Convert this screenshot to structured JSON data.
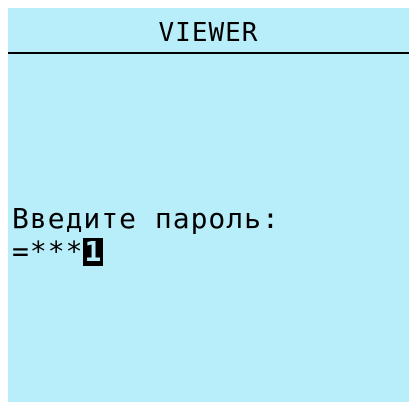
{
  "screen": {
    "title": "VIEWER",
    "prompt": "Введите пароль:",
    "password": {
      "prefix": "=",
      "masked": "***",
      "cursor_digit": "1"
    }
  },
  "colors": {
    "lcd_background": "#b8eefa",
    "text": "#000000",
    "page_background": "#ffffff"
  }
}
